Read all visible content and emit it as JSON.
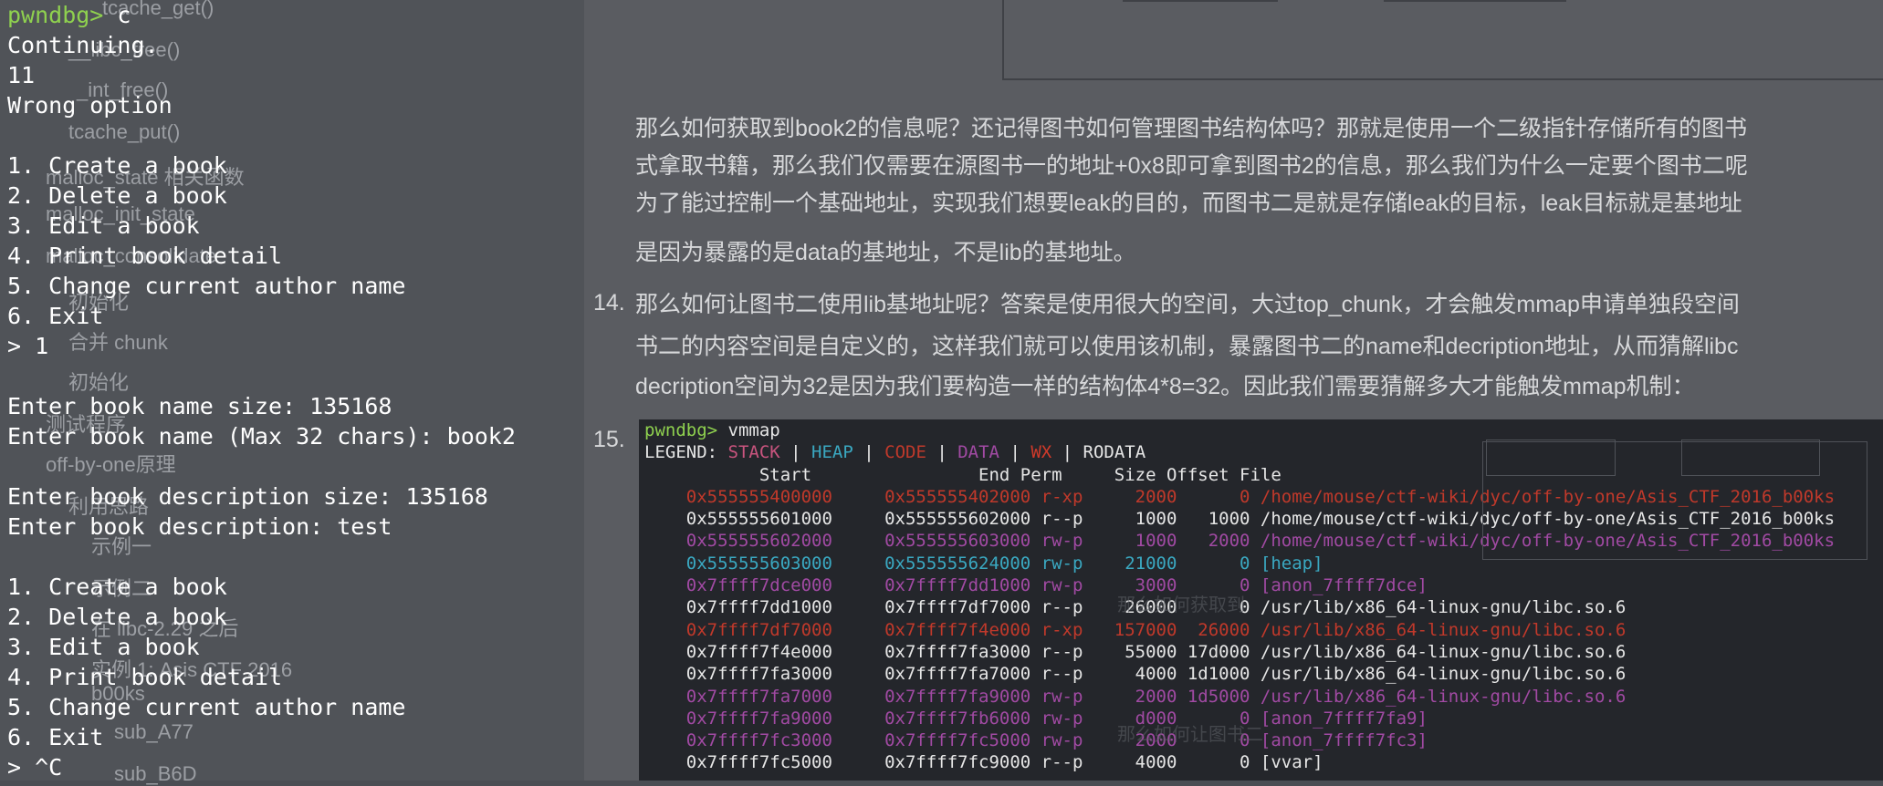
{
  "colors": {
    "prompt": "#8fd14f",
    "stack": "#c9547e",
    "heap": "#3aa8c1",
    "code": "#c0392b",
    "data": "#a14aa3",
    "wx": "#d03a2a",
    "rodata": "#e6e6e6"
  },
  "sidebar": {
    "items": [
      "tcache_get()",
      "__libc_free()",
      "_int_free()",
      "tcache_put()",
      "malloc_state 相关函数",
      "malloc_init_state",
      "malloc_consolidate",
      "初始化",
      "合并 chunk",
      "初始化",
      "测试程序",
      "off-by-one原理",
      "利用思路",
      "示例一",
      "示例二",
      "在 libc-2.29 之后",
      "实例 1: Asis CTF 2016",
      "b00ks",
      "sub_A77",
      "sub_B6D"
    ]
  },
  "doc": {
    "para13": [
      "那么如何获取到book2的信息呢？还记得图书如何管理图书结构体吗？那就是使用一个二级指针存储所有的图书",
      "式拿取书籍，那么我们仅需要在源图书一的地址+0x8即可拿到图书2的信息，那么我们为什么一定要个图书二呢",
      "为了能过控制一个基础地址，实现我们想要leak的目的，而图书二是就是存储leak的目标，leak目标就是基地址",
      "是因为暴露的是data的基地址，不是lib的基地址。"
    ],
    "num14": "14.",
    "para14": [
      "那么如何让图书二使用lib基地址呢？答案是使用很大的空间，大过top_chunk，才会触发mmap申请单独段空间",
      "书二的内容空间是自定义的，这样我们就可以使用该机制，暴露图书二的name和decription地址，从而猜解libc",
      "decription空间为32是因为我们要构造一样的结构体4*8=32。因此我们需要猜解多大才能触发mmap机制："
    ],
    "num15": "15."
  },
  "vmmap": {
    "prompt": "pwndbg> ",
    "command": "vmmap",
    "legend_label": "LEGEND: ",
    "legend": [
      "STACK",
      "HEAP",
      "CODE",
      "DATA",
      "WX",
      "RODATA"
    ],
    "header": "           Start                End Perm     Size Offset File",
    "rows": [
      {
        "t": "code",
        "text": "    0x555555400000     0x555555402000 r-xp     2000      0 /home/mouse/ctf-wiki/dyc/off-by-one/Asis_CTF_2016_b00ks"
      },
      {
        "t": "ro",
        "text": "    0x555555601000     0x555555602000 r--p     1000   1000 /home/mouse/ctf-wiki/dyc/off-by-one/Asis_CTF_2016_b00ks"
      },
      {
        "t": "data",
        "text": "    0x555555602000     0x555555603000 rw-p     1000   2000 /home/mouse/ctf-wiki/dyc/off-by-one/Asis_CTF_2016_b00ks"
      },
      {
        "t": "heap",
        "text": "    0x555555603000     0x555555624000 rw-p    21000      0 [heap]"
      },
      {
        "t": "data",
        "text": "    0x7ffff7dce000     0x7ffff7dd1000 rw-p     3000      0 [anon_7ffff7dce]"
      },
      {
        "t": "ro",
        "text": "    0x7ffff7dd1000     0x7ffff7df7000 r--p    26000      0 /usr/lib/x86_64-linux-gnu/libc.so.6"
      },
      {
        "t": "code",
        "text": "    0x7ffff7df7000     0x7ffff7f4e000 r-xp   157000  26000 /usr/lib/x86_64-linux-gnu/libc.so.6"
      },
      {
        "t": "ro",
        "text": "    0x7ffff7f4e000     0x7ffff7fa3000 r--p    55000 17d000 /usr/lib/x86_64-linux-gnu/libc.so.6"
      },
      {
        "t": "ro",
        "text": "    0x7ffff7fa3000     0x7ffff7fa7000 r--p     4000 1d1000 /usr/lib/x86_64-linux-gnu/libc.so.6"
      },
      {
        "t": "data",
        "text": "    0x7ffff7fa7000     0x7ffff7fa9000 rw-p     2000 1d5000 /usr/lib/x86_64-linux-gnu/libc.so.6"
      },
      {
        "t": "data",
        "text": "    0x7ffff7fa9000     0x7ffff7fb6000 rw-p     d000      0 [anon_7ffff7fa9]"
      },
      {
        "t": "data",
        "text": "    0x7ffff7fc3000     0x7ffff7fc5000 rw-p     2000      0 [anon_7ffff7fc3]"
      },
      {
        "t": "ro",
        "text": "    0x7ffff7fc5000     0x7ffff7fc9000 r--p     4000      0 [vvar]"
      }
    ]
  },
  "terminal": {
    "prompt": "pwndbg> ",
    "lines": [
      "c",
      "Continuing.",
      "11",
      "Wrong option",
      "",
      "1. Create a book",
      "2. Delete a book",
      "3. Edit a book",
      "4. Print book detail",
      "5. Change current author name",
      "6. Exit",
      "> 1",
      "",
      "Enter book name size: 135168",
      "Enter book name (Max 32 chars): book2",
      "",
      "Enter book description size: 135168",
      "Enter book description: test",
      "",
      "1. Create a book",
      "2. Delete a book",
      "3. Edit a book",
      "4. Print book detail",
      "5. Change current author name",
      "6. Exit",
      "> ^C"
    ]
  }
}
